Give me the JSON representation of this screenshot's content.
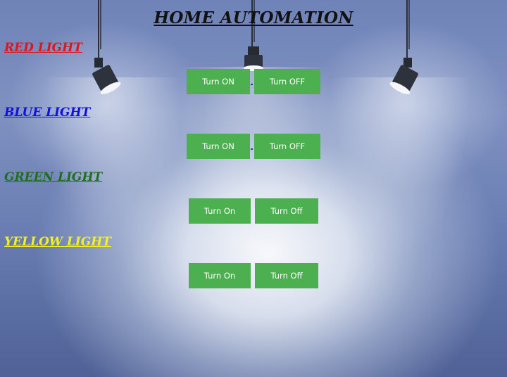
{
  "header": {
    "title": "HOME AUTOMATION"
  },
  "lights": [
    {
      "label": "RED LIGHT",
      "color": "#e0141e",
      "on_label": "Turn ON",
      "off_label": "Turn OFF"
    },
    {
      "label": "BLUE LIGHT",
      "color": "#1010e0",
      "on_label": "Turn ON",
      "off_label": "Turn OFF"
    },
    {
      "label": "GREEN LIGHT",
      "color": "#1f6e1f",
      "on_label": "Turn On",
      "off_label": "Turn Off"
    },
    {
      "label": "YELLOW LIGHT",
      "color": "#f2f21a",
      "on_label": "Turn On",
      "off_label": "Turn Off"
    }
  ],
  "theme": {
    "button_color": "#4caf50",
    "button_text_color": "#ffffff",
    "background_color": "#6f83b8"
  },
  "icons": [
    "spotlight-icon",
    "spotlight-icon",
    "spotlight-icon"
  ]
}
